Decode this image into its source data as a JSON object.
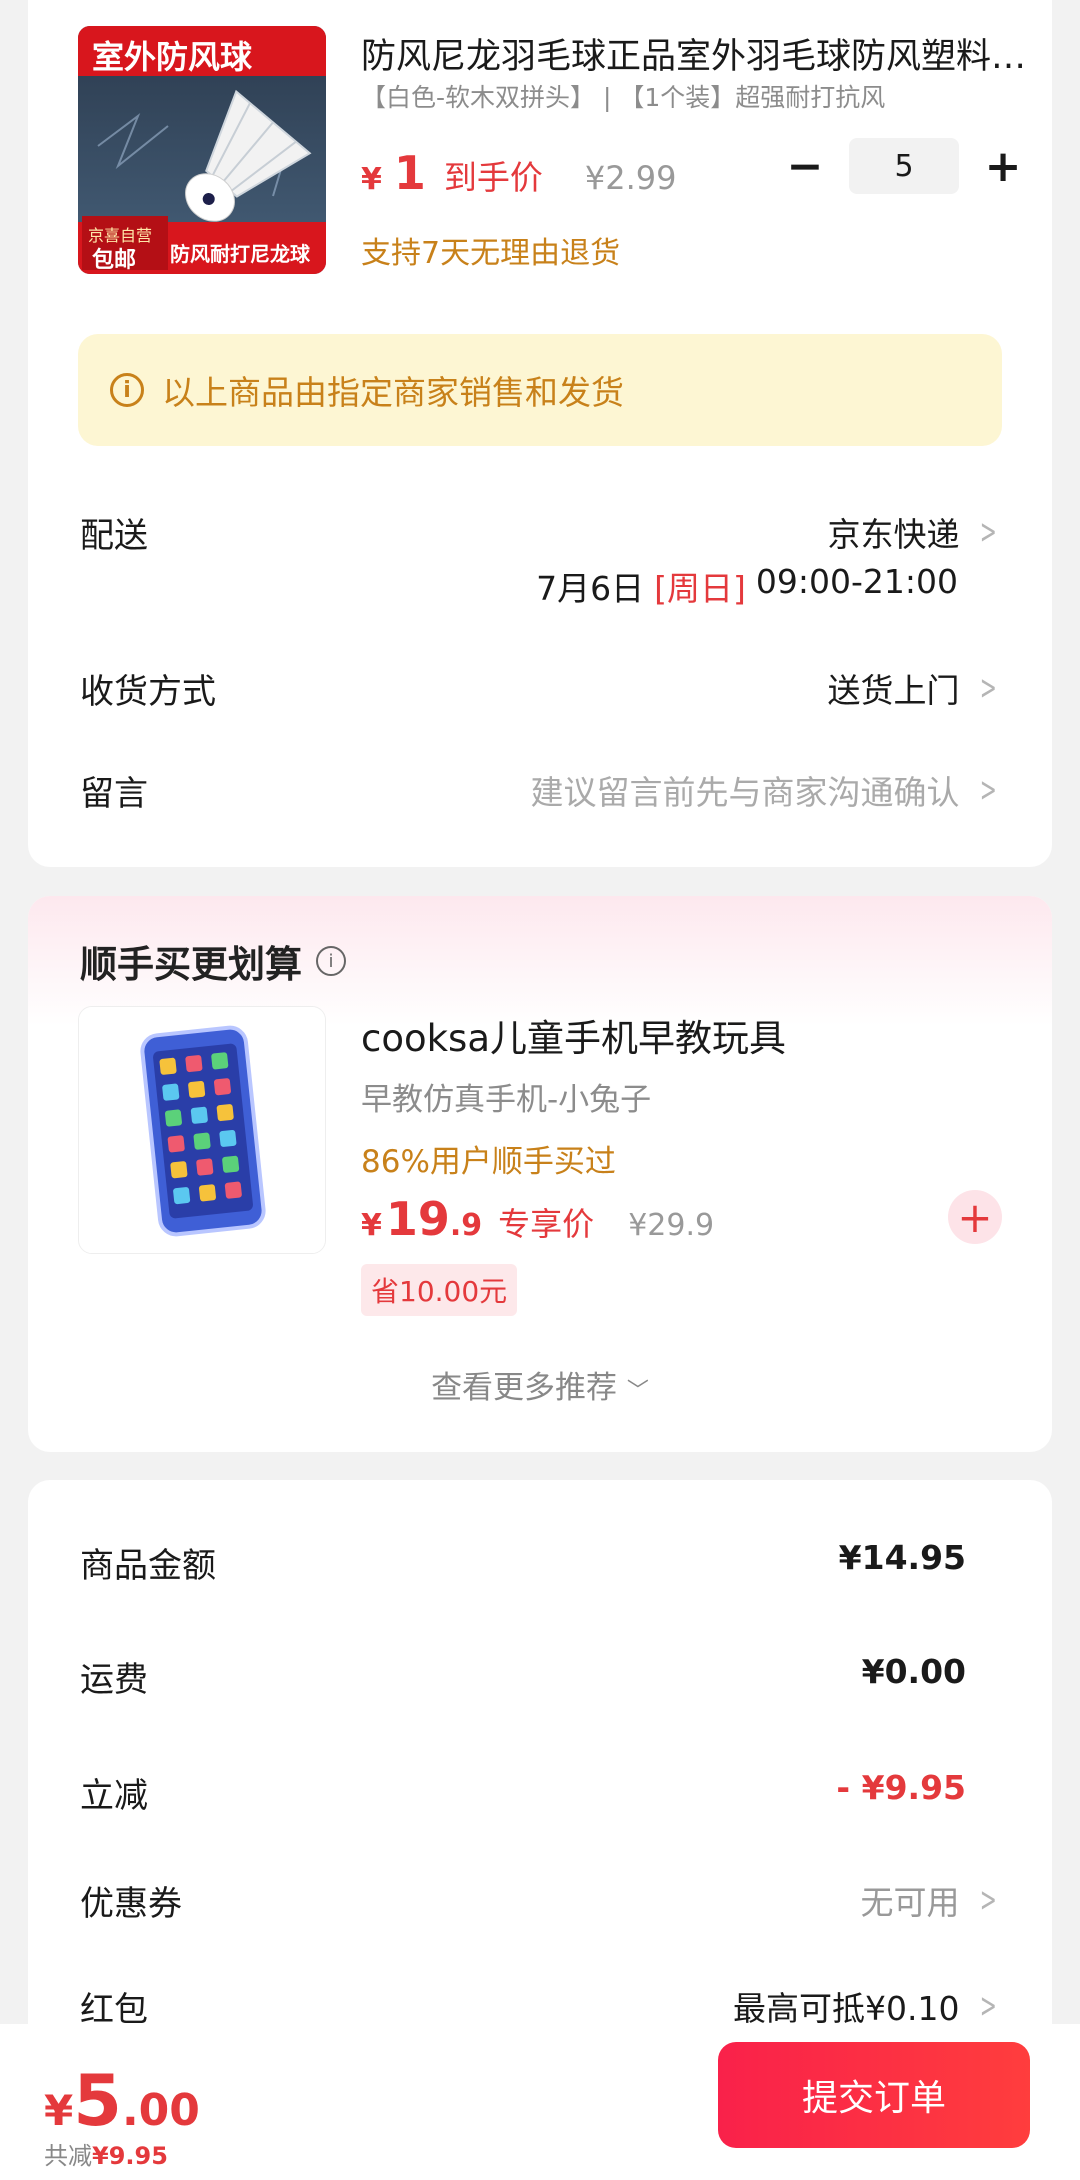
{
  "product": {
    "image_banner": "室外防风球",
    "image_badge_top": "京喜自营",
    "image_badge_bottom": "包邮",
    "image_caption": "防风耐打尼龙球",
    "title": "防风尼龙羽毛球正品室外羽毛球防风塑料羽毛球",
    "spec": "【白色-软木双拼头】 | 【1个装】超强耐打抗风",
    "price_symbol": "¥",
    "price": "1",
    "price_label": "到手价",
    "original_price": "¥2.99",
    "return_note": "支持7天无理由退货",
    "quantity": "5",
    "minus": "−",
    "plus": "+"
  },
  "notice": {
    "icon": "i",
    "text": "以上商品由指定商家销售和发货"
  },
  "delivery": {
    "label": "配送",
    "carrier": "京东快递",
    "date": "7月6日",
    "weekday": "[周日]",
    "time": "09:00-21:00"
  },
  "receive": {
    "label": "收货方式",
    "value": "送货上门"
  },
  "message": {
    "label": "留言",
    "placeholder": "建议留言前先与商家沟通确认"
  },
  "recommend": {
    "title": "顺手买更划算",
    "item_title": "cooksa儿童手机早教玩具",
    "item_sub": "早教仿真手机-小兔子",
    "item_pct": "86%用户顺手买过",
    "price_symbol": "¥",
    "price_int": "19",
    "price_dec": ".9",
    "price_label": "专享价",
    "original_price": "¥29.9",
    "save": "省10.00元",
    "more": "查看更多推荐",
    "more_arrow": "﹀"
  },
  "summary": {
    "rows": [
      {
        "label": "商品金额",
        "value": "¥14.95"
      },
      {
        "label": "运费",
        "value": "¥0.00"
      },
      {
        "label": "立减",
        "value": "- ¥9.95"
      },
      {
        "label": "优惠券",
        "value": "无可用"
      },
      {
        "label": "红包",
        "value": "最高可抵¥0.10"
      }
    ]
  },
  "footer": {
    "symbol": "¥",
    "total_int": "5",
    "total_dec": ".00",
    "saved_label": "共减",
    "saved_value": "¥9.95",
    "submit": "提交订单"
  },
  "colors": {
    "accent": "#e4393c",
    "warning": "#c8811a",
    "notice_bg": "#fdf6d3"
  }
}
